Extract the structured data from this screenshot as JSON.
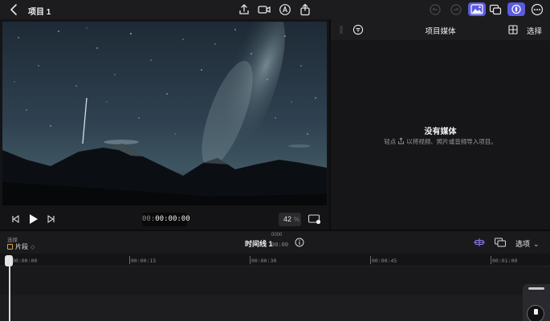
{
  "topbar": {
    "title": "项目 1",
    "icons": [
      "chevron-left-icon",
      "share-upload-icon",
      "camera-record-icon",
      "pen-annotate-icon",
      "export-icon",
      "undo-icon",
      "redo-icon",
      "media-photo-icon",
      "overlay-icon",
      "voiceover-icon",
      "more-icon"
    ]
  },
  "viewer": {
    "timecode_dim": "00:",
    "timecode_main": "00:00:00",
    "zoom_value": "42",
    "zoom_unit": "%"
  },
  "media": {
    "title": "项目媒体",
    "select_label": "选择",
    "empty_title": "没有媒体",
    "empty_hint_before": "轻点",
    "empty_hint_after": "以将视频、照片或音频导入项目。"
  },
  "timeline": {
    "select_label": "选择",
    "clip_label": "片段",
    "name": "时间线 1",
    "tc_top": "0000",
    "tc_sub": "00:00",
    "options_label": "选项",
    "ruler": [
      "00:00:00",
      "00:00:15",
      "00:00:30",
      "00:00:45",
      "00:01:00"
    ]
  },
  "colors": {
    "accent": "#5b5be0",
    "clip_outline": "#d8a040",
    "link_icon": "#8a7ef0"
  }
}
